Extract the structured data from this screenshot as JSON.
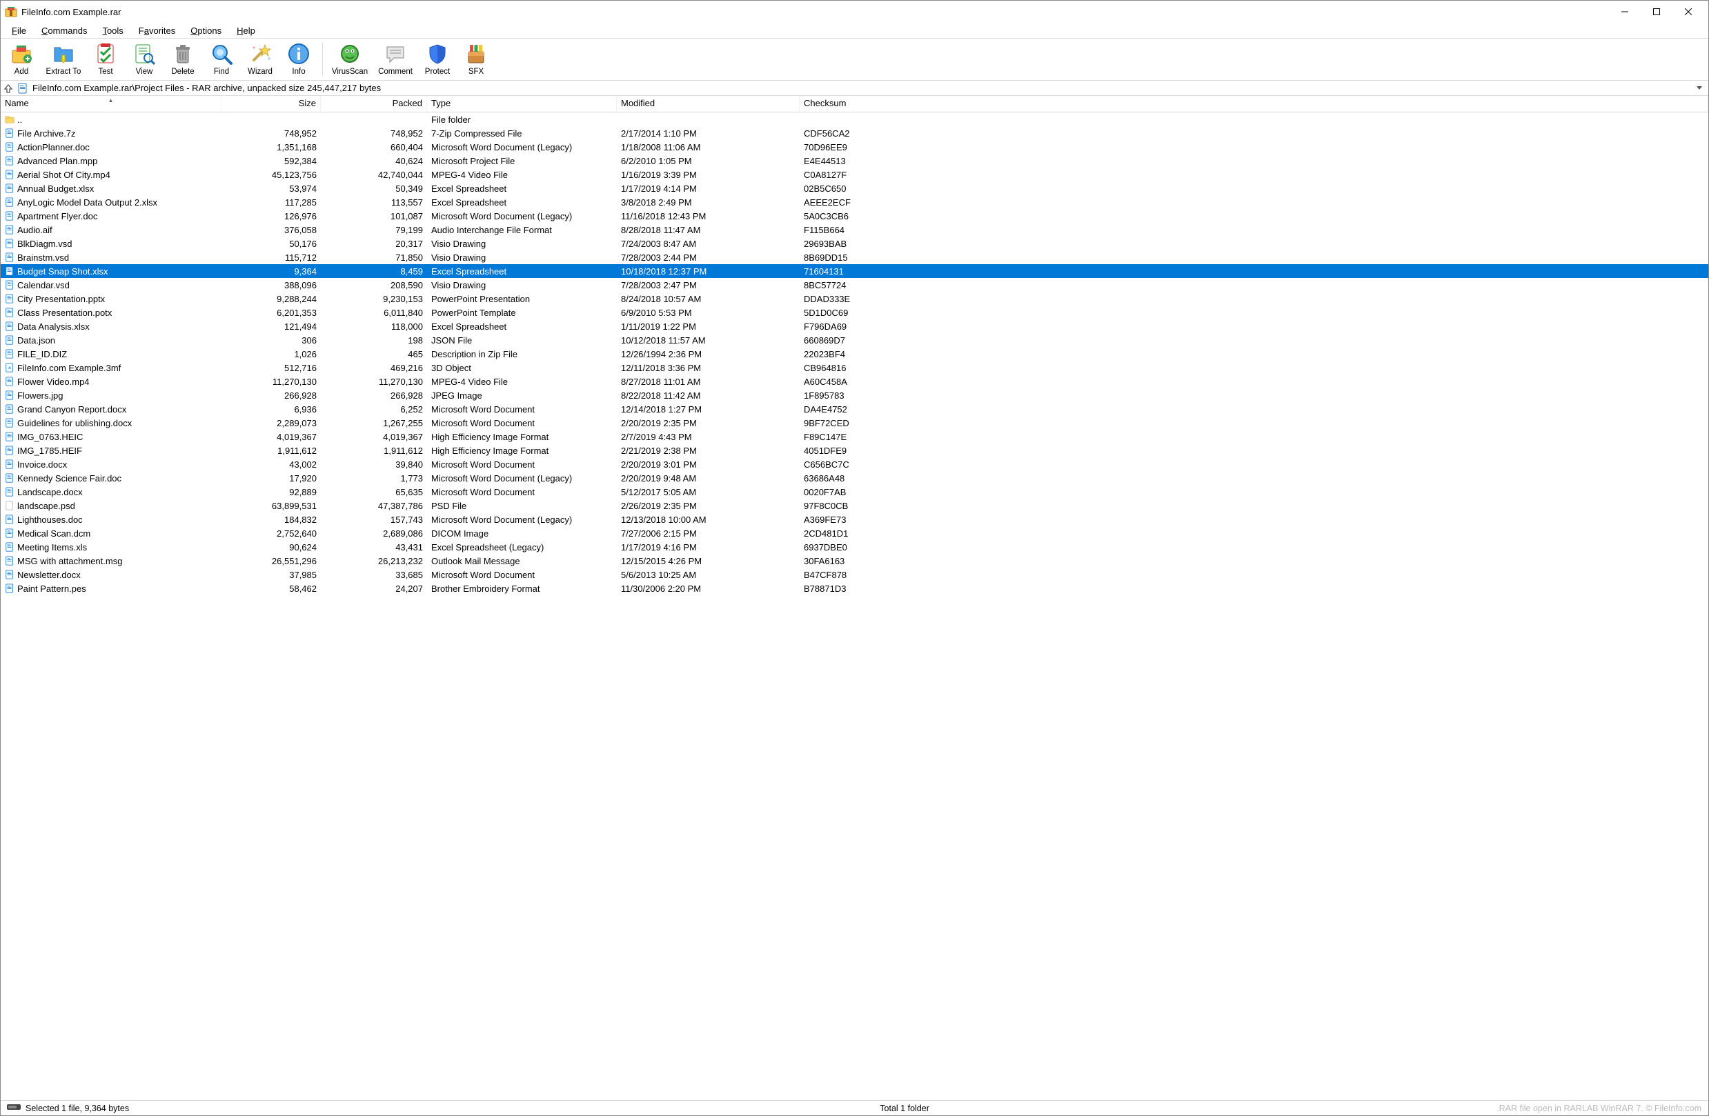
{
  "window": {
    "title": "FileInfo.com Example.rar"
  },
  "menu": {
    "items": [
      {
        "label": "File",
        "ul": 0
      },
      {
        "label": "Commands",
        "ul": 0
      },
      {
        "label": "Tools",
        "ul": 0
      },
      {
        "label": "Favorites",
        "ul": 1
      },
      {
        "label": "Options",
        "ul": 0
      },
      {
        "label": "Help",
        "ul": 0
      }
    ]
  },
  "toolbar": {
    "items": [
      {
        "name": "add",
        "label": "Add"
      },
      {
        "name": "extract",
        "label": "Extract To"
      },
      {
        "name": "test",
        "label": "Test"
      },
      {
        "name": "view",
        "label": "View"
      },
      {
        "name": "delete",
        "label": "Delete"
      },
      {
        "name": "find",
        "label": "Find"
      },
      {
        "name": "wizard",
        "label": "Wizard"
      },
      {
        "name": "info",
        "label": "Info"
      },
      {
        "name": "sep"
      },
      {
        "name": "virusscan",
        "label": "VirusScan"
      },
      {
        "name": "comment",
        "label": "Comment"
      },
      {
        "name": "protect",
        "label": "Protect"
      },
      {
        "name": "sfx",
        "label": "SFX"
      }
    ]
  },
  "address": {
    "path": "FileInfo.com Example.rar\\Project Files - RAR archive, unpacked size 245,447,217 bytes"
  },
  "columns": {
    "name": "Name",
    "size": "Size",
    "packed": "Packed",
    "type": "Type",
    "modified": "Modified",
    "checksum": "Checksum"
  },
  "parent_row": {
    "name": "..",
    "type": "File folder"
  },
  "selected_index": 10,
  "files": [
    {
      "ico": "archive",
      "name": "File Archive.7z",
      "size": "748,952",
      "packed": "748,952",
      "type": "7-Zip Compressed File",
      "modified": "2/17/2014 1:10 PM",
      "checksum": "CDF56CA2"
    },
    {
      "ico": "doc",
      "name": "ActionPlanner.doc",
      "size": "1,351,168",
      "packed": "660,404",
      "type": "Microsoft Word Document (Legacy)",
      "modified": "1/18/2008 11:06 AM",
      "checksum": "70D96EE9"
    },
    {
      "ico": "doc",
      "name": "Advanced Plan.mpp",
      "size": "592,384",
      "packed": "40,624",
      "type": "Microsoft Project File",
      "modified": "6/2/2010 1:05 PM",
      "checksum": "E4E44513"
    },
    {
      "ico": "doc",
      "name": "Aerial Shot Of City.mp4",
      "size": "45,123,756",
      "packed": "42,740,044",
      "type": "MPEG-4 Video File",
      "modified": "1/16/2019 3:39 PM",
      "checksum": "C0A8127F"
    },
    {
      "ico": "doc",
      "name": "Annual Budget.xlsx",
      "size": "53,974",
      "packed": "50,349",
      "type": "Excel Spreadsheet",
      "modified": "1/17/2019 4:14 PM",
      "checksum": "02B5C650"
    },
    {
      "ico": "doc",
      "name": "AnyLogic Model Data Output 2.xlsx",
      "size": "117,285",
      "packed": "113,557",
      "type": "Excel Spreadsheet",
      "modified": "3/8/2018 2:49 PM",
      "checksum": "AEEE2ECF"
    },
    {
      "ico": "doc",
      "name": "Apartment Flyer.doc",
      "size": "126,976",
      "packed": "101,087",
      "type": "Microsoft Word Document (Legacy)",
      "modified": "11/16/2018 12:43 PM",
      "checksum": "5A0C3CB6"
    },
    {
      "ico": "doc",
      "name": "Audio.aif",
      "size": "376,058",
      "packed": "79,199",
      "type": "Audio Interchange File Format",
      "modified": "8/28/2018 11:47 AM",
      "checksum": "F115B664"
    },
    {
      "ico": "doc",
      "name": "BlkDiagm.vsd",
      "size": "50,176",
      "packed": "20,317",
      "type": "Visio Drawing",
      "modified": "7/24/2003 8:47 AM",
      "checksum": "29693BAB"
    },
    {
      "ico": "doc",
      "name": "Brainstm.vsd",
      "size": "115,712",
      "packed": "71,850",
      "type": "Visio Drawing",
      "modified": "7/28/2003 2:44 PM",
      "checksum": "8B69DD15"
    },
    {
      "ico": "doc",
      "name": "Budget Snap Shot.xlsx",
      "size": "9,364",
      "packed": "8,459",
      "type": "Excel Spreadsheet",
      "modified": "10/18/2018 12:37 PM",
      "checksum": "71604131"
    },
    {
      "ico": "doc",
      "name": "Calendar.vsd",
      "size": "388,096",
      "packed": "208,590",
      "type": "Visio Drawing",
      "modified": "7/28/2003 2:47 PM",
      "checksum": "8BC57724"
    },
    {
      "ico": "doc",
      "name": "City Presentation.pptx",
      "size": "9,288,244",
      "packed": "9,230,153",
      "type": "PowerPoint Presentation",
      "modified": "8/24/2018 10:57 AM",
      "checksum": "DDAD333E"
    },
    {
      "ico": "doc",
      "name": "Class Presentation.potx",
      "size": "6,201,353",
      "packed": "6,011,840",
      "type": "PowerPoint Template",
      "modified": "6/9/2010 5:53 PM",
      "checksum": "5D1D0C69"
    },
    {
      "ico": "doc",
      "name": "Data Analysis.xlsx",
      "size": "121,494",
      "packed": "118,000",
      "type": "Excel Spreadsheet",
      "modified": "1/11/2019 1:22 PM",
      "checksum": "F796DA69"
    },
    {
      "ico": "doc",
      "name": "Data.json",
      "size": "306",
      "packed": "198",
      "type": "JSON File",
      "modified": "10/12/2018 11:57 AM",
      "checksum": "660869D7"
    },
    {
      "ico": "doc",
      "name": "FILE_ID.DIZ",
      "size": "1,026",
      "packed": "465",
      "type": "Description in Zip File",
      "modified": "12/26/1994 2:36 PM",
      "checksum": "22023BF4"
    },
    {
      "ico": "3mf",
      "name": "FileInfo.com Example.3mf",
      "size": "512,716",
      "packed": "469,216",
      "type": "3D Object",
      "modified": "12/11/2018 3:36 PM",
      "checksum": "CB964816"
    },
    {
      "ico": "doc",
      "name": "Flower Video.mp4",
      "size": "11,270,130",
      "packed": "11,270,130",
      "type": "MPEG-4 Video File",
      "modified": "8/27/2018 11:01 AM",
      "checksum": "A60C458A"
    },
    {
      "ico": "doc",
      "name": "Flowers.jpg",
      "size": "266,928",
      "packed": "266,928",
      "type": "JPEG Image",
      "modified": "8/22/2018 11:42 AM",
      "checksum": "1F895783"
    },
    {
      "ico": "doc",
      "name": "Grand Canyon Report.docx",
      "size": "6,936",
      "packed": "6,252",
      "type": "Microsoft Word Document",
      "modified": "12/14/2018 1:27 PM",
      "checksum": "DA4E4752"
    },
    {
      "ico": "doc",
      "name": "Guidelines for ublishing.docx",
      "size": "2,289,073",
      "packed": "1,267,255",
      "type": "Microsoft Word Document",
      "modified": "2/20/2019 2:35 PM",
      "checksum": "9BF72CED"
    },
    {
      "ico": "doc",
      "name": "IMG_0763.HEIC",
      "size": "4,019,367",
      "packed": "4,019,367",
      "type": "High Efficiency Image Format",
      "modified": "2/7/2019 4:43 PM",
      "checksum": "F89C147E"
    },
    {
      "ico": "doc",
      "name": "IMG_1785.HEIF",
      "size": "1,911,612",
      "packed": "1,911,612",
      "type": "High Efficiency Image Format",
      "modified": "2/21/2019 2:38 PM",
      "checksum": "4051DFE9"
    },
    {
      "ico": "doc",
      "name": "Invoice.docx",
      "size": "43,002",
      "packed": "39,840",
      "type": "Microsoft Word Document",
      "modified": "2/20/2019 3:01 PM",
      "checksum": "C656BC7C"
    },
    {
      "ico": "doc",
      "name": "Kennedy Science Fair.doc",
      "size": "17,920",
      "packed": "1,773",
      "type": "Microsoft Word Document (Legacy)",
      "modified": "2/20/2019 9:48 AM",
      "checksum": "63686A48"
    },
    {
      "ico": "doc",
      "name": "Landscape.docx",
      "size": "92,889",
      "packed": "65,635",
      "type": "Microsoft Word Document",
      "modified": "5/12/2017 5:05 AM",
      "checksum": "0020F7AB"
    },
    {
      "ico": "blank",
      "name": "landscape.psd",
      "size": "63,899,531",
      "packed": "47,387,786",
      "type": "PSD File",
      "modified": "2/26/2019 2:35 PM",
      "checksum": "97F8C0CB"
    },
    {
      "ico": "doc",
      "name": "Lighthouses.doc",
      "size": "184,832",
      "packed": "157,743",
      "type": "Microsoft Word Document (Legacy)",
      "modified": "12/13/2018 10:00 AM",
      "checksum": "A369FE73"
    },
    {
      "ico": "doc",
      "name": "Medical Scan.dcm",
      "size": "2,752,640",
      "packed": "2,689,086",
      "type": "DICOM Image",
      "modified": "7/27/2006 2:15 PM",
      "checksum": "2CD481D1"
    },
    {
      "ico": "doc",
      "name": "Meeting Items.xls",
      "size": "90,624",
      "packed": "43,431",
      "type": "Excel Spreadsheet (Legacy)",
      "modified": "1/17/2019 4:16 PM",
      "checksum": "6937DBE0"
    },
    {
      "ico": "doc",
      "name": "MSG with attachment.msg",
      "size": "26,551,296",
      "packed": "26,213,232",
      "type": "Outlook Mail Message",
      "modified": "12/15/2015 4:26 PM",
      "checksum": "30FA6163"
    },
    {
      "ico": "doc",
      "name": "Newsletter.docx",
      "size": "37,985",
      "packed": "33,685",
      "type": "Microsoft Word Document",
      "modified": "5/6/2013 10:25 AM",
      "checksum": "B47CF878"
    },
    {
      "ico": "doc",
      "name": "Paint Pattern.pes",
      "size": "58,462",
      "packed": "24,207",
      "type": "Brother Embroidery Format",
      "modified": "11/30/2006 2:20 PM",
      "checksum": "B78871D3"
    }
  ],
  "status": {
    "left": "Selected 1 file, 9,364 bytes",
    "center": "Total 1 folder",
    "right": ".RAR file open in RARLAB WinRAR 7. © FileInfo.com"
  }
}
